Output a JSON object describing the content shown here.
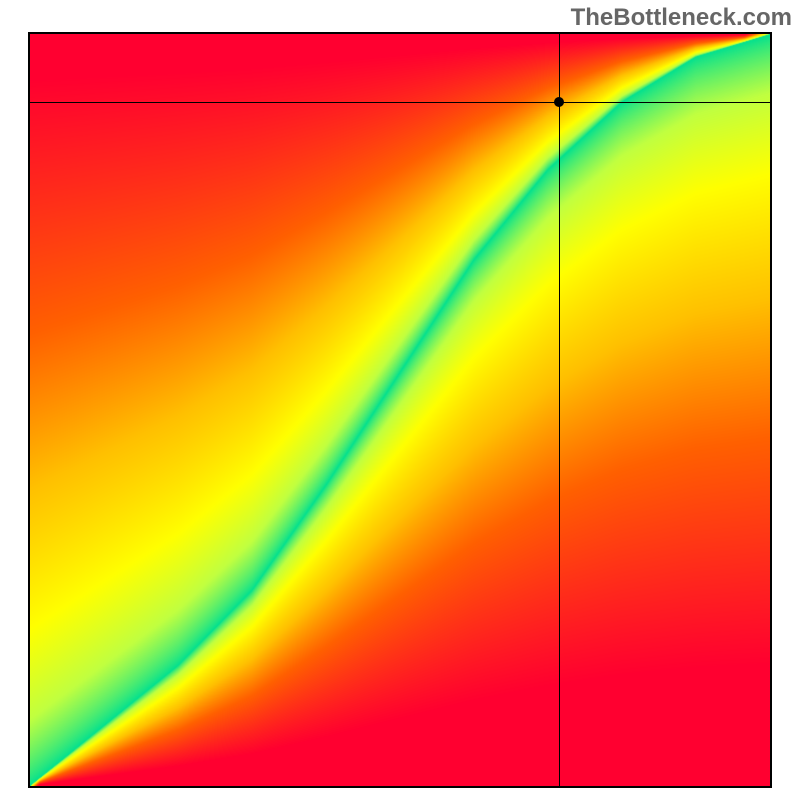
{
  "watermark": "TheBottleneck.com",
  "chart_data": {
    "type": "heatmap",
    "title": "",
    "xlabel": "",
    "ylabel": "",
    "x_range": [
      0,
      100
    ],
    "y_range": [
      0,
      100
    ],
    "grid": false,
    "legend": false,
    "crosshair": {
      "x": 71.5,
      "y": 91
    },
    "marker": {
      "x": 71.5,
      "y": 91
    },
    "description": "Bottleneck heatmap. Green diagonal band (low bottleneck) runs from lower-left to upper-right. Away from band colors shift through yellow and orange to red (high bottleneck). Upper-left half is predominantly red-to-orange-to-yellow moving toward band; lower-right half is orange-to-yellow-to-red moving away from band.",
    "color_scale": {
      "0": "#00e090",
      "0.15": "#c0ff40",
      "0.3": "#ffff00",
      "0.5": "#ffc000",
      "0.7": "#ff6000",
      "1": "#ff0030"
    },
    "optimal_band": [
      {
        "x": 0,
        "y": 0
      },
      {
        "x": 10,
        "y": 8
      },
      {
        "x": 20,
        "y": 16
      },
      {
        "x": 30,
        "y": 26
      },
      {
        "x": 40,
        "y": 40
      },
      {
        "x": 50,
        "y": 55
      },
      {
        "x": 60,
        "y": 70
      },
      {
        "x": 70,
        "y": 82
      },
      {
        "x": 80,
        "y": 91
      },
      {
        "x": 90,
        "y": 97
      },
      {
        "x": 100,
        "y": 100
      }
    ]
  }
}
